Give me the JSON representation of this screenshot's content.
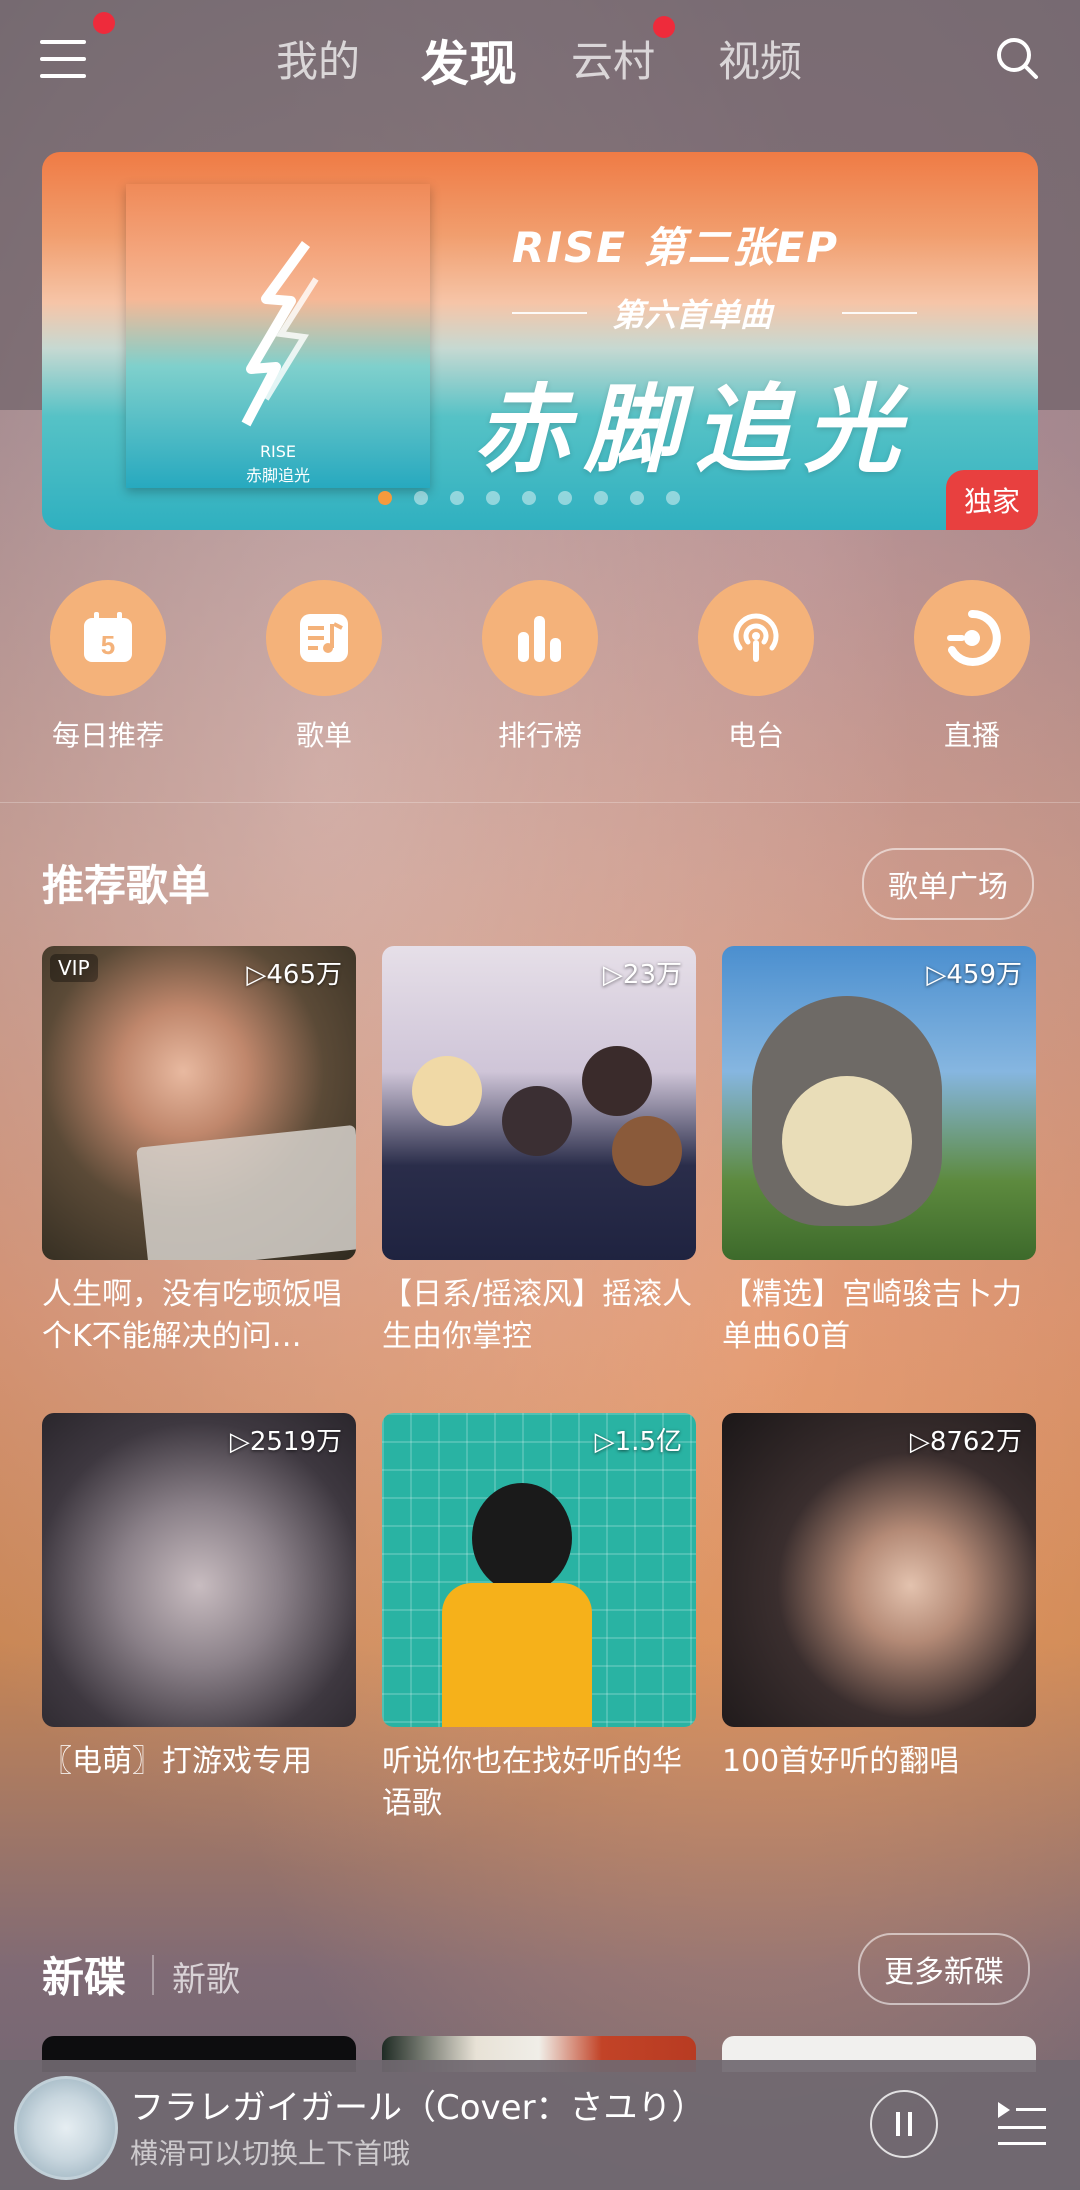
{
  "topbar": {
    "tabs": [
      "我的",
      "发现",
      "云村",
      "视频"
    ],
    "active_tab": "发现"
  },
  "banner": {
    "ep_title": "RISE 第二张EP",
    "subtitle": "第六首单曲",
    "main_title": "赤脚追光",
    "cover_artist": "RISE",
    "cover_title": "赤脚追光",
    "badge": "独家"
  },
  "shortcuts": [
    {
      "label": "每日推荐",
      "icon": "calendar-icon",
      "day": "5"
    },
    {
      "label": "歌单",
      "icon": "playlist-icon"
    },
    {
      "label": "排行榜",
      "icon": "chart-icon"
    },
    {
      "label": "电台",
      "icon": "radio-icon"
    },
    {
      "label": "直播",
      "icon": "live-icon"
    }
  ],
  "recommended": {
    "title": "推荐歌单",
    "more": "歌单广场",
    "items": [
      {
        "count": "▷465万",
        "vip": "VIP",
        "title": "人生啊，没有吃顿饭唱个K不能解决的问…"
      },
      {
        "count": "▷23万",
        "title": "【日系/摇滚风】摇滚人生由你掌控"
      },
      {
        "count": "▷459万",
        "title": "【精选】宫崎骏吉卜力单曲60首"
      },
      {
        "count": "▷2519万",
        "title": "〖电萌〗打游戏专用"
      },
      {
        "count": "▷1.5亿",
        "title": "听说你也在找好听的华语歌"
      },
      {
        "count": "▷8762万",
        "title": "100首好听的翻唱"
      }
    ]
  },
  "new_releases": {
    "title": "新碟",
    "alt_tab": "新歌",
    "more": "更多新碟"
  },
  "player": {
    "song": "フラレガイガール（Cover：さユり）",
    "hint": "横滑可以切换上下首哦"
  },
  "colors": {
    "accent_orange": "#f4b27a",
    "badge_red": "#e8403f",
    "notify_red": "#ee2b3b"
  }
}
